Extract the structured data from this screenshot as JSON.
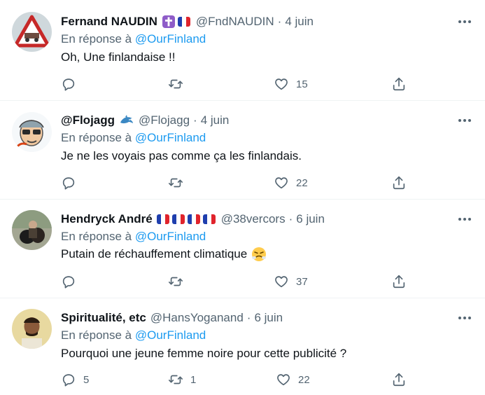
{
  "tweets": [
    {
      "name": "Fernand NAUDIN",
      "name_emojis": [
        "latin-cross-emoji",
        "french-flag-emoji"
      ],
      "handle": "@FndNAUDIN",
      "date": "4 juin",
      "reply_prefix": "En réponse à",
      "reply_to": "@OurFinland",
      "text": "Oh, Une finlandaise !!",
      "replies": "",
      "retweets": "",
      "likes": "15"
    },
    {
      "name": "@Flojagg",
      "name_emojis": [
        "dolphin-emoji"
      ],
      "handle": "@Flojagg",
      "date": "4 juin",
      "reply_prefix": "En réponse à",
      "reply_to": "@OurFinland",
      "text": "Je ne les voyais pas comme ça les finlandais.",
      "replies": "",
      "retweets": "",
      "likes": "22"
    },
    {
      "name": "Hendryck André",
      "name_emojis": [
        "french-flag-emoji",
        "french-flag-emoji",
        "french-flag-emoji",
        "french-flag-emoji"
      ],
      "handle": "@38vercors",
      "date": "6 juin",
      "reply_prefix": "En réponse à",
      "reply_to": "@OurFinland",
      "text": "Putain de réchauffement climatique",
      "text_emoji": "steaming-face-emoji",
      "replies": "",
      "retweets": "",
      "likes": "37"
    },
    {
      "name": "Spiritualité, etc",
      "name_emojis": [],
      "handle": "@HansYoganand",
      "date": "6 juin",
      "reply_prefix": "En réponse à",
      "reply_to": "@OurFinland",
      "text": "Pourquoi une jeune femme noire pour cette publicité ?",
      "replies": "5",
      "retweets": "1",
      "likes": "22"
    }
  ],
  "colors": {
    "text": "#0f1419",
    "muted": "#536471",
    "link": "#1d9bf0",
    "divider": "#eff3f4"
  },
  "icons": [
    "reply-icon",
    "retweet-icon",
    "like-icon",
    "share-icon",
    "more-icon"
  ]
}
